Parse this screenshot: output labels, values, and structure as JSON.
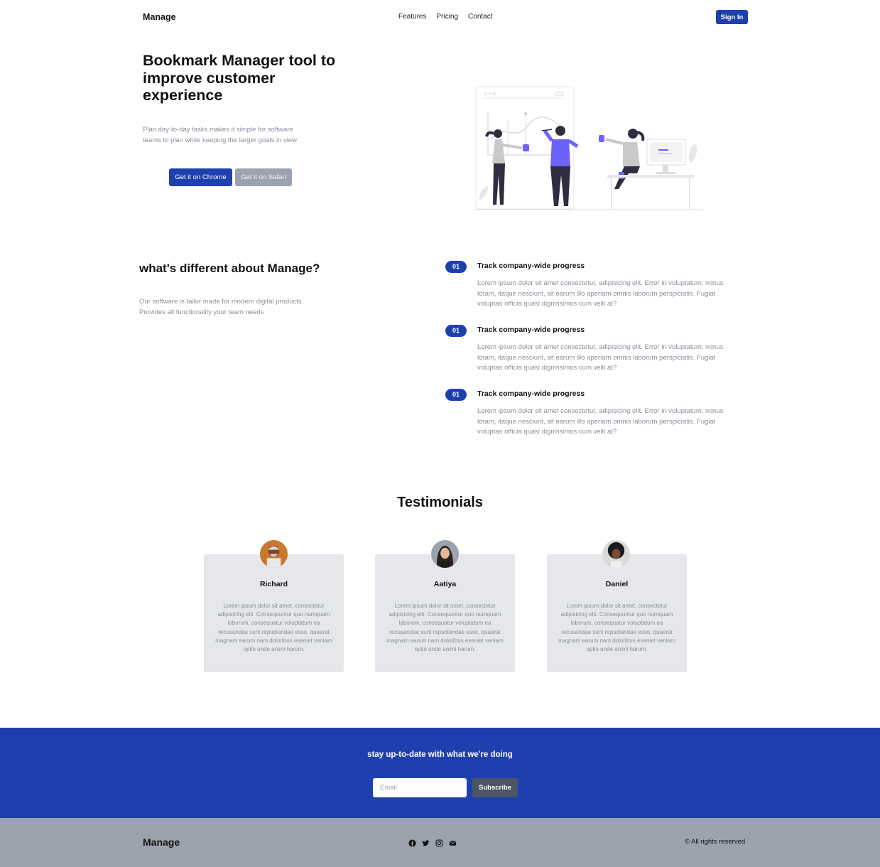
{
  "nav": {
    "brand": "Manage",
    "links": [
      "Features",
      "Pricing",
      "Contact"
    ],
    "signin": "Sign In"
  },
  "hero": {
    "title": "Bookmark Manager tool to improve customer experience",
    "subtitle": "Plan day-to-day tasks makes it simple for software teams to plan while keeping the larger goals in view",
    "chrome_button": "Get it on Chrome",
    "safari_button": "Get it on Safari",
    "illustration": "team-collaboration-illustration"
  },
  "different": {
    "title": "what's different about Manage?",
    "subtitle": "Our software is tailor made for modern digital products. Provides all functionality your team needs",
    "features": [
      {
        "num": "01",
        "title": "Track company-wide progress",
        "desc": "Lorem ipsum dolor sit amet consectetur, adipisicing elit. Error in voluptatum, minus totam, itaque nesciunt, sit earum illo aperiam omnis laborum perspiciatis. Fugiat voluptas officia quasi dignissimos cum velit at?"
      },
      {
        "num": "01",
        "title": "Track company-wide progress",
        "desc": "Lorem ipsum dolor sit amet consectetur, adipisicing elit. Error in voluptatum, minus totam, itaque nesciunt, sit earum illo aperiam omnis laborum perspiciatis. Fugiat voluptas officia quasi dignissimos cum velit at?"
      },
      {
        "num": "01",
        "title": "Track company-wide progress",
        "desc": "Lorem ipsum dolor sit amet consectetur, adipisicing elit. Error in voluptatum, minus totam, itaque nesciunt, sit earum illo aperiam omnis laborum perspiciatis. Fugiat voluptas officia quasi dignissimos cum velit at?"
      }
    ]
  },
  "testimonials": {
    "title": "Testimonials",
    "cards": [
      {
        "name": "Richard",
        "text": "Lorem ipsum dolor sit amet, consectetur adipisicing elit. Consequuntur quo numquam laborum, consequatur voluptatum ea recusandae sunt repudiandae esse, quaerat magnam earum nam doloribus eveniet veniam optio unde animi harum."
      },
      {
        "name": "Aatiya",
        "text": "Lorem ipsum dolor sit amet, consectetur adipisicing elit. Consequuntur quo numquam laborum, consequatur voluptatum ea recusandae sunt repudiandae esse, quaerat magnam earum nam doloribus eveniet veniam optio unde animi harum."
      },
      {
        "name": "Daniel",
        "text": "Lorem ipsum dolor sit amet, consectetur adipisicing elit. Consequuntur quo numquam laborum, consequatur voluptatum ea recusandae sunt repudiandae esse, quaerat magnam earum nam doloribus eveniet veniam optio unde animi harum."
      }
    ]
  },
  "newsletter": {
    "title": "stay up-to-date with what we're doing",
    "placeholder": "Email",
    "button": "Subscribe"
  },
  "footer": {
    "brand": "Manage",
    "icons": [
      "facebook-icon",
      "twitter-icon",
      "instagram-icon",
      "envelope-icon"
    ],
    "copyright": "© All rights reserved"
  },
  "colors": {
    "primary": "#1e40af",
    "muted_text": "#8a8f9a",
    "card_bg": "#e5e7eb",
    "footer_bg": "#9ca3af",
    "subscribe_bg": "#4b5563"
  }
}
